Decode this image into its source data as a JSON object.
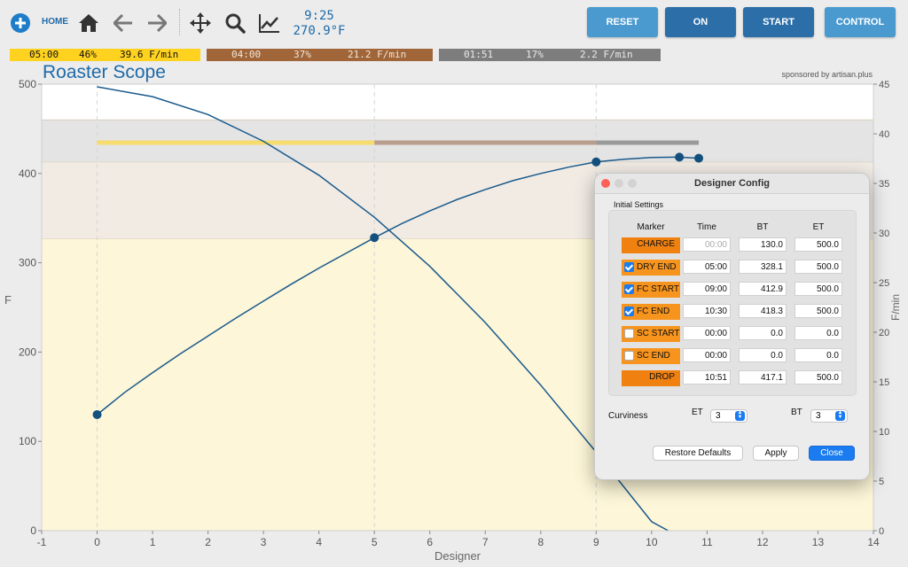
{
  "toolbar": {
    "home_label": "HOME",
    "lcd_time": "9:25",
    "lcd_temp": "270.9°F",
    "buttons": {
      "reset": "RESET",
      "on": "ON",
      "start": "START",
      "control": "CONTROL"
    },
    "icons": [
      "add-icon",
      "home-icon",
      "back-arrow-icon",
      "forward-arrow-icon",
      "pan-icon",
      "zoom-icon",
      "line-chart-icon"
    ]
  },
  "phases": [
    {
      "time": "05:00",
      "percent": "46%",
      "rate": "39.6 F/min",
      "color": "#ffd21f"
    },
    {
      "time": "04:00",
      "percent": "37%",
      "rate": "21.2 F/min",
      "color": "#a0663a"
    },
    {
      "time": "01:51",
      "percent": "17%",
      "rate": "2.2 F/min",
      "color": "#7d7d7d"
    }
  ],
  "chart": {
    "title": "Roaster Scope",
    "sponsor": "sponsored by artisan.plus",
    "ylabel_left": "F",
    "ylabel_right": "F/min",
    "xlabel": "Designer"
  },
  "chart_data": {
    "type": "line",
    "title": "Roaster Scope",
    "xlabel": "Designer",
    "ylabel": "F",
    "y2label": "F/min",
    "xlim": [
      -1,
      14
    ],
    "ylim": [
      0,
      500
    ],
    "y2lim": [
      0,
      45
    ],
    "xticks": [
      -1,
      0,
      1,
      2,
      3,
      4,
      5,
      6,
      7,
      8,
      9,
      10,
      11,
      12,
      13,
      14
    ],
    "yticks": [
      0,
      100,
      200,
      300,
      400,
      500
    ],
    "y2ticks": [
      0,
      5,
      10,
      15,
      20,
      25,
      30,
      35,
      40,
      45
    ],
    "grid": false,
    "bands": [
      {
        "from": 0,
        "to": 327,
        "color": "#fdf6d8"
      },
      {
        "from": 327,
        "to": 413,
        "color": "#f1ebe4"
      },
      {
        "from": 413,
        "to": 460,
        "color": "#e4e4e4"
      }
    ],
    "phase_bar_y": 434,
    "phase_segments": [
      {
        "from": 0,
        "to": 5,
        "color": "#f6dc6e"
      },
      {
        "from": 5,
        "to": 9,
        "color": "#b89d8c"
      },
      {
        "from": 9,
        "to": 10.85,
        "color": "#9a9a9a"
      }
    ],
    "series": [
      {
        "curve": "bt",
        "color": "#1a5a8c",
        "x": [
          0,
          0.5,
          1,
          1.5,
          2,
          2.5,
          3,
          3.5,
          4,
          4.5,
          5,
          5.5,
          6,
          6.5,
          7,
          7.5,
          8,
          8.5,
          9,
          9.5,
          10,
          10.5,
          10.85
        ],
        "y": [
          130,
          155,
          177,
          198,
          218,
          238,
          257,
          276,
          294,
          311,
          328.1,
          344,
          358,
          371,
          382,
          392,
          400,
          407,
          412.9,
          416,
          418,
          418.3,
          417.1
        ],
        "markers": [
          {
            "x": 0,
            "y": 130.0
          },
          {
            "x": 5,
            "y": 328.1
          },
          {
            "x": 9,
            "y": 412.9
          },
          {
            "x": 10.5,
            "y": 418.3
          },
          {
            "x": 10.85,
            "y": 417.1
          }
        ]
      },
      {
        "curve": "et",
        "color": "#1a5a8c",
        "x": [
          0,
          1,
          2,
          3,
          4,
          5,
          6,
          7,
          8,
          9,
          10,
          10.3
        ],
        "y": [
          497,
          486,
          466,
          436,
          398,
          351,
          296,
          233,
          163,
          88,
          10,
          0
        ]
      }
    ]
  },
  "dialog": {
    "title": "Designer Config",
    "group_title": "Initial Settings",
    "headers": {
      "marker": "Marker",
      "time": "Time",
      "bt": "BT",
      "et": "ET"
    },
    "rows": [
      {
        "label": "CHARGE",
        "checkbox": false,
        "checked": false,
        "time": "00:00",
        "time_disabled": true,
        "bt": "130.0",
        "et": "500.0"
      },
      {
        "label": "DRY END",
        "checkbox": true,
        "checked": true,
        "time": "05:00",
        "time_disabled": false,
        "bt": "328.1",
        "et": "500.0"
      },
      {
        "label": "FC START",
        "checkbox": true,
        "checked": true,
        "time": "09:00",
        "time_disabled": false,
        "bt": "412.9",
        "et": "500.0"
      },
      {
        "label": "FC END",
        "checkbox": true,
        "checked": true,
        "time": "10:30",
        "time_disabled": false,
        "bt": "418.3",
        "et": "500.0"
      },
      {
        "label": "SC START",
        "checkbox": true,
        "checked": false,
        "time": "00:00",
        "time_disabled": false,
        "bt": "0.0",
        "et": "0.0"
      },
      {
        "label": "SC END",
        "checkbox": true,
        "checked": false,
        "time": "00:00",
        "time_disabled": false,
        "bt": "0.0",
        "et": "0.0"
      },
      {
        "label": "DROP",
        "checkbox": false,
        "checked": false,
        "time": "10:51",
        "time_disabled": false,
        "bt": "417.1",
        "et": "500.0"
      }
    ],
    "curviness_label": "Curviness",
    "curviness_et_label": "ET",
    "curviness_et_value": "3",
    "curviness_bt_label": "BT",
    "curviness_bt_value": "3",
    "buttons": {
      "restore": "Restore Defaults",
      "apply": "Apply",
      "close": "Close"
    }
  }
}
